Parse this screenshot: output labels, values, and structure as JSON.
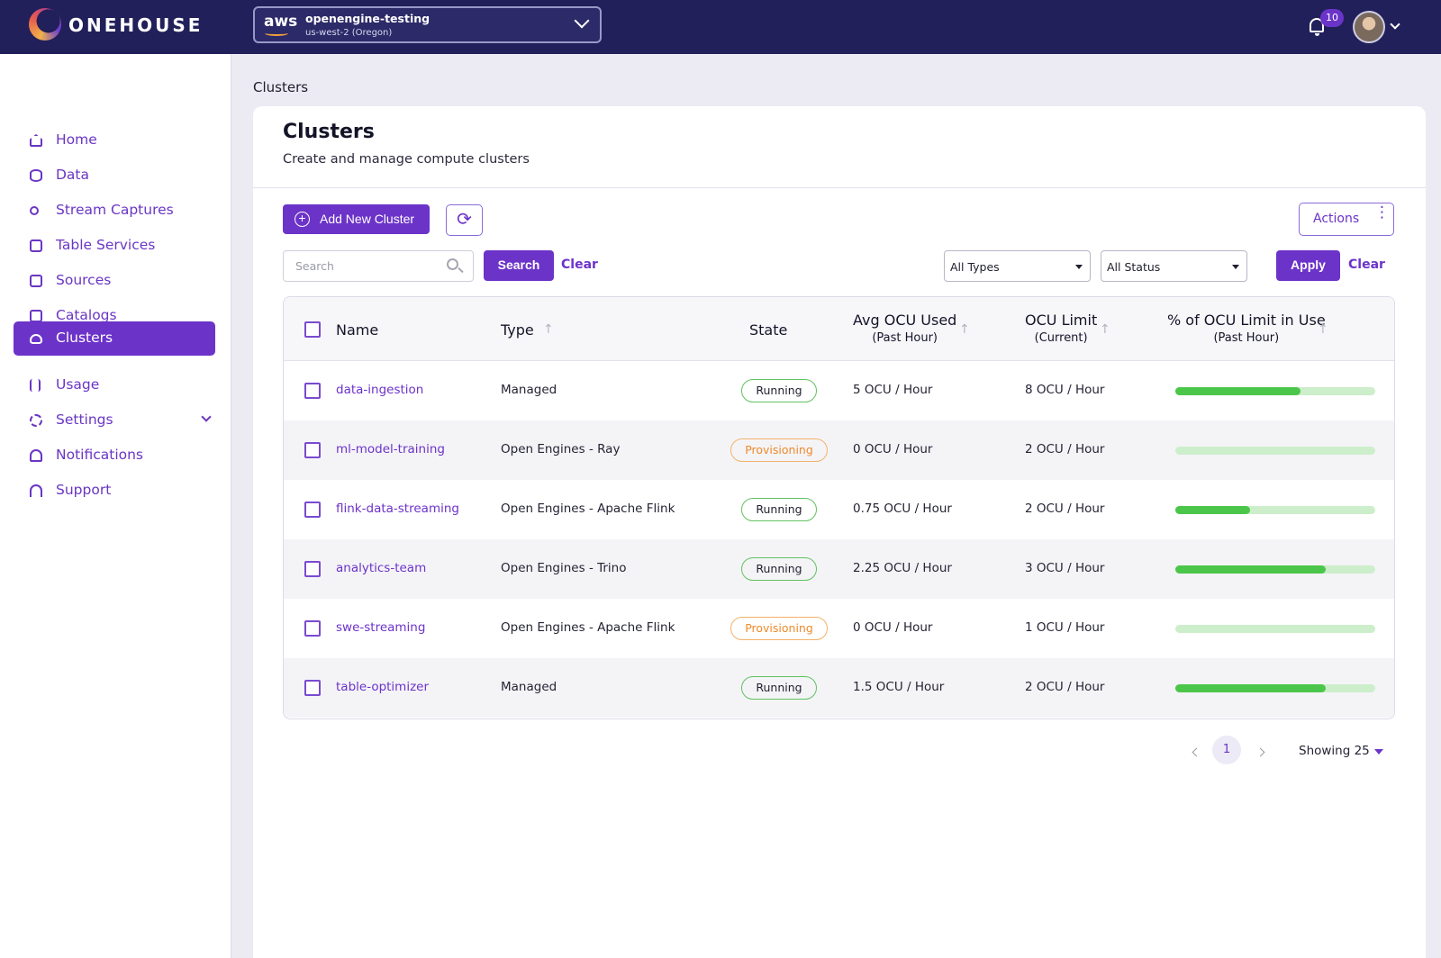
{
  "brand": {
    "name": "ONEHOUSE"
  },
  "project": {
    "provider": "aws",
    "name": "openengine-testing",
    "region": "us-west-2 (Oregon)"
  },
  "header": {
    "notification_count": "10"
  },
  "sidebar": {
    "items": [
      {
        "label": "Home",
        "icon": "home-icon"
      },
      {
        "label": "Data",
        "icon": "database-icon"
      },
      {
        "label": "Stream Captures",
        "icon": "stream-icon"
      },
      {
        "label": "Table Services",
        "icon": "table-icon"
      },
      {
        "label": "Sources",
        "icon": "sources-icon"
      },
      {
        "label": "Catalogs",
        "icon": "catalog-icon"
      },
      {
        "label": "Clusters",
        "icon": "cloud-icon",
        "active": true
      },
      {
        "label": "Usage",
        "icon": "bar-chart-icon"
      },
      {
        "label": "Settings",
        "icon": "gear-icon",
        "expandable": true
      },
      {
        "label": "Notifications",
        "icon": "bell-icon"
      },
      {
        "label": "Support",
        "icon": "headset-icon"
      }
    ]
  },
  "breadcrumb": "Clusters",
  "page": {
    "title": "Clusters",
    "subtitle": "Create and manage compute clusters"
  },
  "toolbar": {
    "add_label": "Add New Cluster",
    "actions_label": "Actions",
    "search_placeholder": "Search",
    "search_label": "Search",
    "clear_label": "Clear",
    "type_filter": "All Types",
    "status_filter": "All Status",
    "apply_label": "Apply",
    "clear_filters_label": "Clear"
  },
  "table": {
    "columns": {
      "name": "Name",
      "type": "Type",
      "state": "State",
      "avg_ocu": "Avg OCU Used",
      "avg_ocu_sub": "(Past Hour)",
      "ocu_limit": "OCU Limit",
      "ocu_limit_sub": "(Current)",
      "pct": "% of OCU Limit in Use",
      "pct_sub": "(Past Hour)"
    },
    "rows": [
      {
        "name": "data-ingestion",
        "type": "Managed",
        "state": "Running",
        "avg": "5 OCU / Hour",
        "limit": "8 OCU / Hour",
        "pct": 0.625
      },
      {
        "name": "ml-model-training",
        "type": "Open Engines - Ray",
        "state": "Provisioning",
        "avg": "0 OCU / Hour",
        "limit": "2 OCU / Hour",
        "pct": 0
      },
      {
        "name": "flink-data-streaming",
        "type": "Open Engines - Apache Flink",
        "state": "Running",
        "avg": "0.75 OCU / Hour",
        "limit": "2 OCU / Hour",
        "pct": 0.375
      },
      {
        "name": "analytics-team",
        "type": "Open Engines - Trino",
        "state": "Running",
        "avg": "2.25 OCU / Hour",
        "limit": "3 OCU / Hour",
        "pct": 0.75
      },
      {
        "name": "swe-streaming",
        "type": "Open Engines - Apache Flink",
        "state": "Provisioning",
        "avg": "0 OCU / Hour",
        "limit": "1 OCU / Hour",
        "pct": 0
      },
      {
        "name": "table-optimizer",
        "type": "Managed",
        "state": "Running",
        "avg": "1.5 OCU / Hour",
        "limit": "2 OCU / Hour",
        "pct": 0.75
      }
    ]
  },
  "pagination": {
    "page": "1",
    "showing": "Showing 25"
  },
  "colors": {
    "brand": "#6c33c9",
    "topbar": "#22205a",
    "running": "#4cc64a",
    "provisioning": "#ef8a2a"
  }
}
